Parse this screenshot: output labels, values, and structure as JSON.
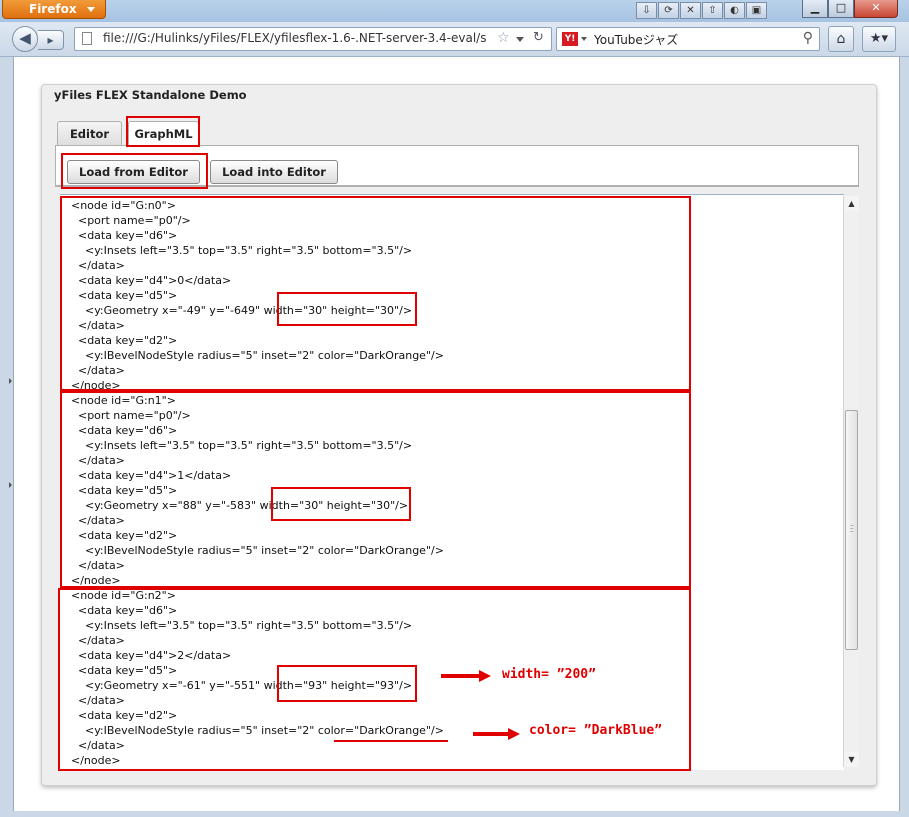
{
  "browser": {
    "menu_button": "Firefox",
    "url": "file:///G:/Hulinks/yFiles/FLEX/yfilesflex-1.6-.NET-server-3.4-eval/s",
    "search_text": "YouTubeジャズ",
    "search_engine_label": "Y!"
  },
  "app": {
    "title": "yFiles FLEX Standalone Demo",
    "tabs": [
      "Editor",
      "GraphML"
    ],
    "buttons": {
      "load_from_editor": "Load from Editor",
      "load_into_editor": "Load into Editor"
    }
  },
  "xml_lines": [
    "  <node id=\"G:n0\">",
    "    <port name=\"p0\"/>",
    "    <data key=\"d6\">",
    "      <y:Insets left=\"3.5\" top=\"3.5\" right=\"3.5\" bottom=\"3.5\"/>",
    "    </data>",
    "    <data key=\"d4\">0</data>",
    "    <data key=\"d5\">",
    "      <y:Geometry x=\"-49\" y=\"-649\" width=\"30\" height=\"30\"/>",
    "    </data>",
    "    <data key=\"d2\">",
    "      <y:IBevelNodeStyle radius=\"5\" inset=\"2\" color=\"DarkOrange\"/>",
    "    </data>",
    "  </node>",
    "  <node id=\"G:n1\">",
    "    <port name=\"p0\"/>",
    "    <data key=\"d6\">",
    "      <y:Insets left=\"3.5\" top=\"3.5\" right=\"3.5\" bottom=\"3.5\"/>",
    "    </data>",
    "    <data key=\"d4\">1</data>",
    "    <data key=\"d5\">",
    "      <y:Geometry x=\"88\" y=\"-583\" width=\"30\" height=\"30\"/>",
    "    </data>",
    "    <data key=\"d2\">",
    "      <y:IBevelNodeStyle radius=\"5\" inset=\"2\" color=\"DarkOrange\"/>",
    "    </data>",
    "  </node>",
    "  <node id=\"G:n2\">",
    "    <data key=\"d6\">",
    "      <y:Insets left=\"3.5\" top=\"3.5\" right=\"3.5\" bottom=\"3.5\"/>",
    "    </data>",
    "    <data key=\"d4\">2</data>",
    "    <data key=\"d5\">",
    "      <y:Geometry x=\"-61\" y=\"-551\" width=\"93\" height=\"93\"/>",
    "    </data>",
    "    <data key=\"d2\">",
    "      <y:IBevelNodeStyle radius=\"5\" inset=\"2\" color=\"DarkOrange\"/>",
    "    </data>",
    "  </node>"
  ],
  "annotations": {
    "width_note": "width= ”200”",
    "color_note": "color= ”DarkBlue”"
  },
  "colors": {
    "annotation": "#e00000",
    "firefox_orange": "#e0700f"
  }
}
